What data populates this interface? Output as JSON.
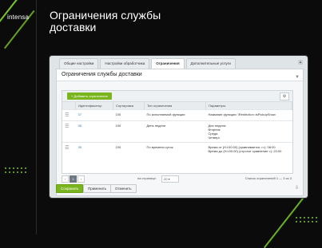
{
  "brand": "intensa",
  "hero_title": "Ограничения службы доставки",
  "tabs": [
    "Общие настройки",
    "Настройки обработчика",
    "Ограничения",
    "Дополнительные услуги"
  ],
  "panel_title": "Ограничения службы доставки",
  "add_button": "Добавить ограничение",
  "columns": [
    "Идентификатор",
    "Сортировка",
    "Тип ограничения",
    "Параметры"
  ],
  "rows": [
    {
      "id": "37",
      "sort": "100",
      "type": "По исполняемой функции",
      "params": [
        "Название функции: \\Restriction::isPickupShow"
      ]
    },
    {
      "id": "36",
      "sort": "100",
      "type": "День недели",
      "params": [
        "Дни недели:",
        "Вторник",
        "Среда",
        "Четверг"
      ]
    },
    {
      "id": "35",
      "sort": "100",
      "type": "По времени суток",
      "params": [
        "Время от (Н:i:00:00) (сравнивается >=): 08:00",
        "Время до (Н:i:00:00) (строгое сравнение <): 23:00"
      ]
    }
  ],
  "pager": {
    "current": "1",
    "per_page_label": "на странице:",
    "per_page_value": "20",
    "total": "Список ограничений 1 — 3 из 3"
  },
  "footer": {
    "save": "Сохранить",
    "apply": "Применить",
    "cancel": "Отменить"
  }
}
